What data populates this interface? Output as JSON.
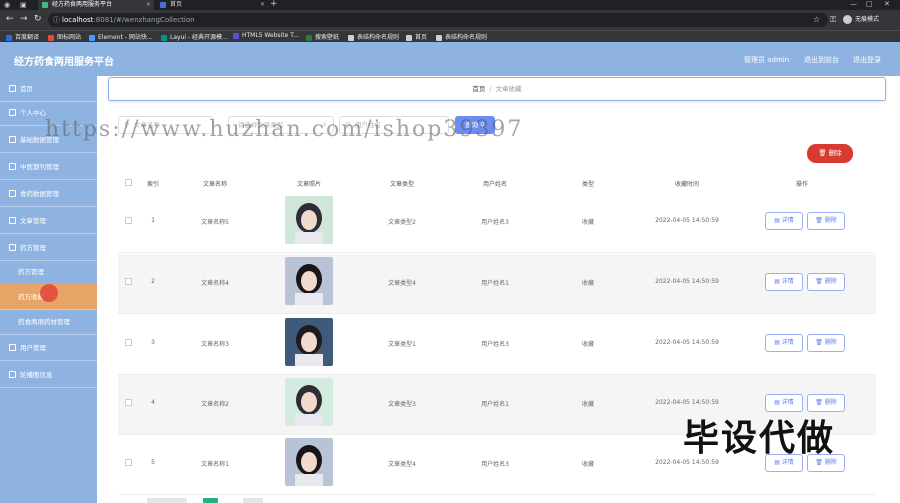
{
  "browser": {
    "tabs": [
      {
        "label": "经方药食两用服务平台",
        "active": true,
        "icon": "vue-icon",
        "color": "#42b883"
      },
      {
        "label": "首页",
        "active": false,
        "icon": "page-icon",
        "color": "#4a6fd8"
      }
    ],
    "url_host": "localhost",
    "url_rest": ":8081/#/wenzhangCollection",
    "profile_label": "无痕模式",
    "bookmarks": [
      {
        "label": "百度翻译",
        "color": "#2c6be0"
      },
      {
        "label": "图标网站",
        "color": "#e24d3a"
      },
      {
        "label": "Element - 网站快...",
        "color": "#409eff"
      },
      {
        "label": "Layui - 经典开源模...",
        "color": "#009688"
      },
      {
        "label": "HTML5 Website T...",
        "color": "#5a4fcf"
      },
      {
        "label": "搜索壁纸",
        "color": "#2f7d32"
      },
      {
        "label": "表结构命名规则",
        "color": "#cfcfcf"
      },
      {
        "label": "首页",
        "color": "#cfcfcf"
      },
      {
        "label": "表结构命名规则",
        "color": "#cfcfcf"
      }
    ]
  },
  "header": {
    "title": "经方药食两用服务平台",
    "admin_label": "管理员 admin",
    "back_label": "退出到前台",
    "logout_label": "退出登录"
  },
  "sidebar": {
    "items": [
      {
        "label": "首页",
        "sub": false,
        "active": false
      },
      {
        "label": "个人中心",
        "sub": false,
        "active": false
      },
      {
        "label": "基础数据管理",
        "sub": false,
        "active": false
      },
      {
        "label": "中医期刊管理",
        "sub": false,
        "active": false
      },
      {
        "label": "食药数据管理",
        "sub": false,
        "active": false
      },
      {
        "label": "文章管理",
        "sub": false,
        "active": false
      },
      {
        "label": "药方管理",
        "sub": false,
        "active": false
      },
      {
        "label": "药方管理",
        "sub": true,
        "active": false
      },
      {
        "label": "药方收藏",
        "sub": true,
        "active": true
      },
      {
        "label": "药食两用药材管理",
        "sub": true,
        "active": false
      },
      {
        "label": "用户管理",
        "sub": false,
        "active": false
      },
      {
        "label": "轮播图信息",
        "sub": false,
        "active": false
      }
    ]
  },
  "breadcrumb": {
    "home": "首页",
    "current": "文章收藏"
  },
  "filters": {
    "name_placeholder": "文章名称",
    "type_placeholder": "请选择文章类型",
    "user_placeholder": "用户姓名",
    "search_label": "查询"
  },
  "bulk_delete_label": "删除",
  "watermark_text": "https://www.huzhan.com/ishop39397",
  "overlay_text": "毕设代做",
  "table": {
    "headers": [
      "索引",
      "文章名称",
      "文章照片",
      "文章类型",
      "用户姓名",
      "类型",
      "收藏时间",
      "操作"
    ],
    "detail_label": "详情",
    "delete_label": "删除",
    "rows": [
      {
        "index": "1",
        "name": "文章名称5",
        "type": "文章类型2",
        "user": "用户姓名3",
        "kind": "收藏",
        "time": "2022-04-05 14:50:59",
        "thumb_bg": "#cfe6d8",
        "thumb_fg": "#2d2d35"
      },
      {
        "index": "2",
        "name": "文章名称4",
        "type": "文章类型4",
        "user": "用户姓名1",
        "kind": "收藏",
        "time": "2022-04-05 14:50:59",
        "thumb_bg": "#b8c4d6",
        "thumb_fg": "#1a1518"
      },
      {
        "index": "3",
        "name": "文章名称3",
        "type": "文章类型1",
        "user": "用户姓名3",
        "kind": "收藏",
        "time": "2022-04-05 14:50:59",
        "thumb_bg": "#3f5a7a",
        "thumb_fg": "#201a1c"
      },
      {
        "index": "4",
        "name": "文章名称2",
        "type": "文章类型3",
        "user": "用户姓名1",
        "kind": "收藏",
        "time": "2022-04-05 14:50:59",
        "thumb_bg": "#d4ece0",
        "thumb_fg": "#2d2d35"
      },
      {
        "index": "5",
        "name": "文章名称1",
        "type": "文章类型4",
        "user": "用户姓名3",
        "kind": "收藏",
        "time": "2022-04-05 14:50:59",
        "thumb_bg": "#b8c4d6",
        "thumb_fg": "#1a1518"
      }
    ]
  },
  "colors": {
    "accent": "#8fb3e0",
    "active": "#e8a366",
    "primary": "#6c8cf5",
    "danger": "#d83a2f"
  }
}
